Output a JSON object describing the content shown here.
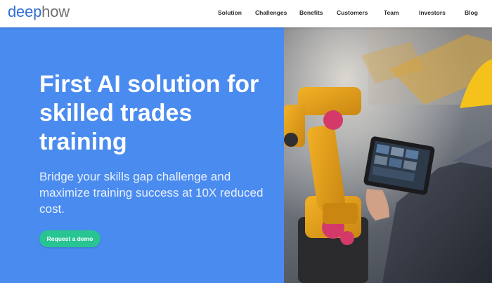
{
  "brand": {
    "logo_part1": "deep",
    "logo_part2": "how"
  },
  "nav": {
    "items": [
      {
        "label": "Solution"
      },
      {
        "label": "Challenges"
      },
      {
        "label": "Benefits"
      },
      {
        "label": "Customers"
      },
      {
        "label": "Team"
      },
      {
        "label": "Investors"
      },
      {
        "label": "Blog"
      }
    ]
  },
  "hero": {
    "title": "First AI solution for skilled trades training",
    "subtitle": "Bridge your skills gap challenge and maximize training success at 10X reduced cost.",
    "cta_label": "Request a demo"
  },
  "colors": {
    "hero_bg": "#4a8bf0",
    "cta_bg": "#28c592",
    "logo_blue": "#2f6fd6",
    "logo_gray": "#6f6f6f"
  }
}
